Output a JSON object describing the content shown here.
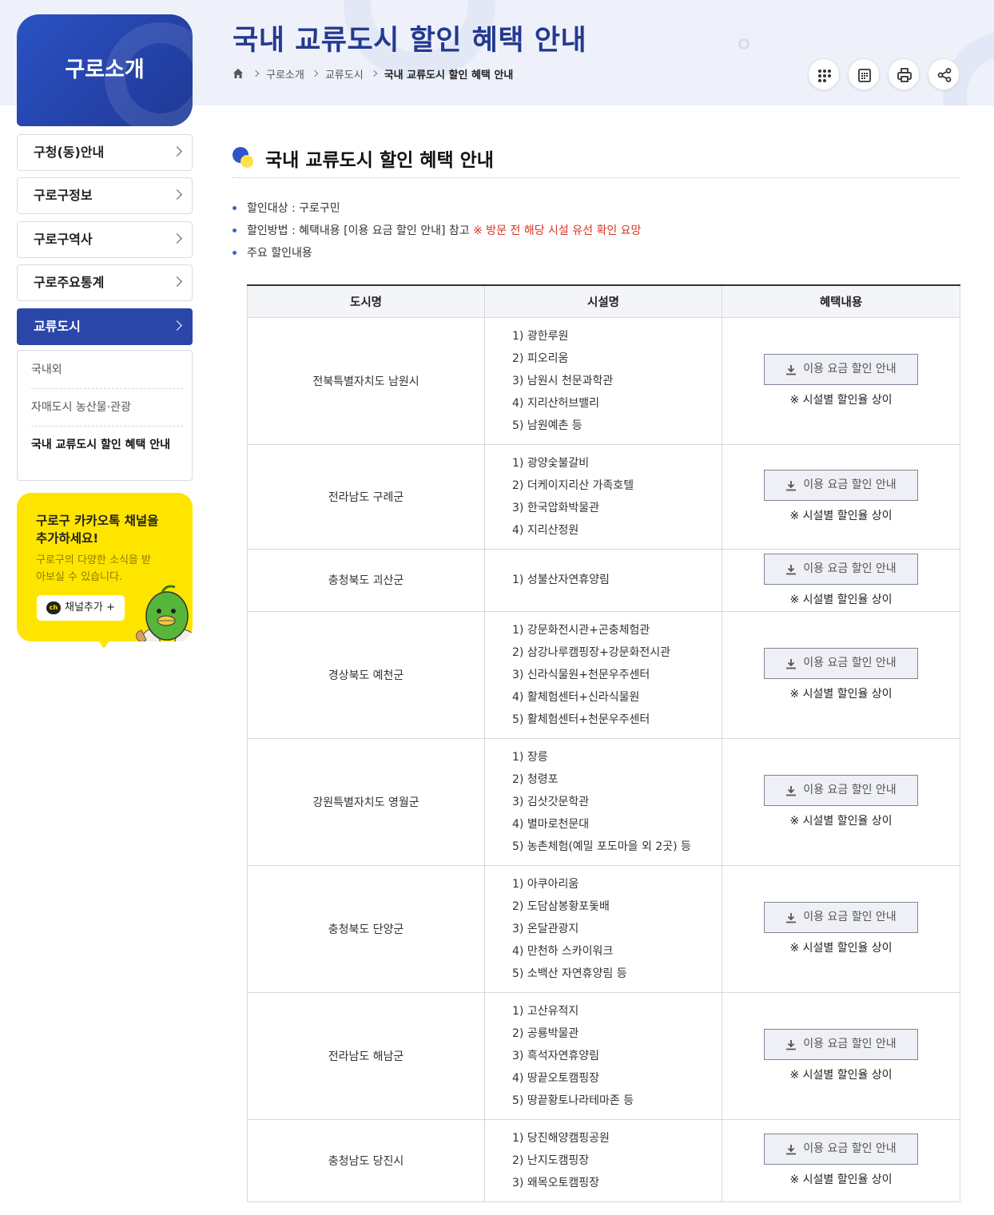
{
  "sidebar": {
    "title": "구로소개",
    "menu": [
      {
        "label": "구청(동)안내"
      },
      {
        "label": "구로구정보"
      },
      {
        "label": "구로구역사"
      },
      {
        "label": "구로주요통계"
      },
      {
        "label": "교류도시"
      }
    ],
    "submenu": [
      {
        "label": "국내외"
      },
      {
        "label": "자매도시 농산물·관광"
      },
      {
        "label": "국내 교류도시 할인 혜택 안내"
      }
    ],
    "kakao": {
      "title": "구로구 카카오톡 채널을 추가하세요!",
      "desc": "구로구의 다양한 소식을 받아보실 수 있습니다.",
      "button": "채널추가 +",
      "ch_label": "ch"
    }
  },
  "header": {
    "title": "국내 교류도시 할인 혜택 안내",
    "breadcrumb": [
      "구로소개",
      "교류도시",
      "국내 교류도시 할인 혜택 안내"
    ],
    "tools": [
      "apps-icon",
      "calendar-icon",
      "print-icon",
      "share-icon"
    ]
  },
  "content": {
    "section_title": "국내 교류도시 할인 혜택 안내",
    "bullets": {
      "target": "할인대상 : 구로구민",
      "method": "할인방법 : 혜택내용 [이용 요금 할인 안내] 참고 ",
      "method_warn": "※ 방문 전 해당 시설 유선 확인 요망",
      "main": "주요 할인내용"
    },
    "table": {
      "headers": [
        "도시명",
        "시설명",
        "혜택내용"
      ],
      "button_label": "이용 요금 할인 안내",
      "note": "※ 시설별 할인율 상이",
      "rows": [
        {
          "city": "전북특별자치도 남원시",
          "facilities": [
            "1) 광한루원",
            "2) 피오리움",
            "3) 남원시 천문과학관",
            "4) 지리산허브밸리",
            "5) 남원예촌 등"
          ]
        },
        {
          "city": "전라남도 구례군",
          "facilities": [
            "1) 광양숯불갈비",
            "2) 더케이지리산 가족호텔",
            "3) 한국압화박물관",
            "4) 지리산정원"
          ]
        },
        {
          "city": "충청북도 괴산군",
          "facilities": [
            "1) 성불산자연휴양림"
          ]
        },
        {
          "city": "경상북도 예천군",
          "facilities": [
            "1) 강문화전시관+곤충체험관",
            "2) 삼강나루캠핑장+강문화전시관",
            "3) 신라식물원+천문우주센터",
            "4) 활체험센터+신라식물원",
            "5) 활체험센터+천문우주센터"
          ]
        },
        {
          "city": "강원특별자치도 영월군",
          "facilities": [
            "1) 장릉",
            "2) 청령포",
            "3) 김삿갓문학관",
            "4) 별마로천문대",
            "5) 농촌체험(예밀 포도마을 외 2곳) 등"
          ]
        },
        {
          "city": "충청북도 단양군",
          "facilities": [
            "1) 아쿠아리움",
            "2) 도담삼봉황포돛배",
            "3) 온달관광지",
            "4) 만천하 스카이워크",
            "5) 소백산 자연휴양림 등"
          ]
        },
        {
          "city": "전라남도 해남군",
          "facilities": [
            "1) 고산유적지",
            "2) 공룡박물관",
            "3) 흑석자연휴양림",
            "4) 땅끝오토캠핑장",
            "5) 땅끝황토나라테마존 등"
          ]
        },
        {
          "city": "충청남도 당진시",
          "facilities": [
            "1) 당진해양캠핑공원",
            "2) 난지도캠핑장",
            "3) 왜목오토캠핑장"
          ]
        }
      ]
    }
  },
  "colors": {
    "primary": "#2a46a8",
    "title": "#24398f",
    "warn": "#d9321f",
    "kakao": "#fee500"
  }
}
